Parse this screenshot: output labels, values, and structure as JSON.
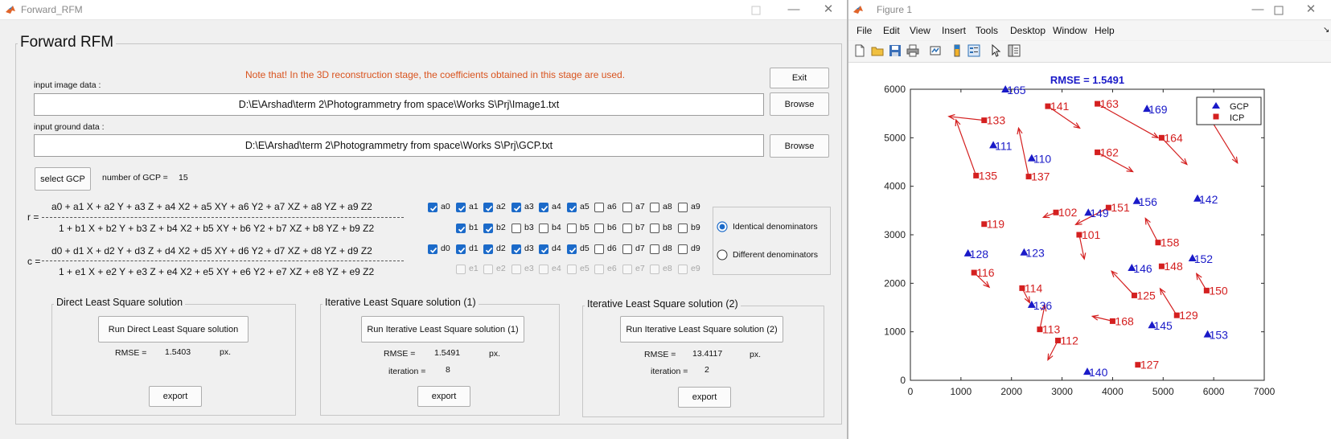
{
  "left_window": {
    "title": "Forward_RFM",
    "panel_title": "Forward RFM",
    "note": "Note that! In the 3D reconstruction stage, the coefficients obtained in this stage are used.",
    "exit_label": "Exit",
    "image_label": "input image data :",
    "image_path": "D:\\E\\Arshad\\term 2\\Photogrammetry from space\\Works S\\Prj\\Image1.txt",
    "browse_label": "Browse",
    "ground_label": "input ground data :",
    "ground_path": "D:\\E\\Arshad\\term 2\\Photogrammetry from space\\Works S\\Prj\\GCP.txt",
    "select_gcp_label": "select GCP",
    "num_gcp_label": "number of GCP =",
    "num_gcp_value": "15",
    "r_label": "r =",
    "r_num": "a0 + a1 X + a2 Y + a3 Z + a4 X2 + a5 XY + a6 Y2 + a7 XZ + a8 YZ + a9 Z2",
    "r_den": "1 + b1 X + b2 Y + b3 Z + b4 X2 + b5 XY + b6 Y2 + b7 XZ + b8 YZ + b9 Z2",
    "c_label": "c =",
    "c_num": "d0 + d1 X + d2 Y + d3 Z + d4 X2 + d5 XY + d6 Y2 + d7 XZ + d8 YZ + d9 Z2",
    "c_den": "1 + e1 X + e2 Y + e3 Z + e4 X2 + e5 XY + e6 Y2 + e7 XZ + e8 YZ + e9 Z2",
    "coef_rows": [
      {
        "labels": [
          "a0",
          "a1",
          "a2",
          "a3",
          "a4",
          "a5",
          "a6",
          "a7",
          "a8",
          "a9"
        ],
        "state": [
          "on",
          "on",
          "on",
          "on",
          "on",
          "on",
          "off",
          "off",
          "off",
          "off"
        ]
      },
      {
        "labels": [
          "",
          "b1",
          "b2",
          "b3",
          "b4",
          "b5",
          "b6",
          "b7",
          "b8",
          "b9"
        ],
        "state": [
          "none",
          "on",
          "on",
          "off",
          "off",
          "off",
          "off",
          "off",
          "off",
          "off"
        ]
      },
      {
        "labels": [
          "d0",
          "d1",
          "d2",
          "d3",
          "d4",
          "d5",
          "d6",
          "d7",
          "d8",
          "d9"
        ],
        "state": [
          "on",
          "on",
          "on",
          "on",
          "on",
          "on",
          "off",
          "off",
          "off",
          "off"
        ]
      },
      {
        "labels": [
          "",
          "e1",
          "e2",
          "e3",
          "e4",
          "e5",
          "e6",
          "e7",
          "e8",
          "e9"
        ],
        "state": [
          "none",
          "dis",
          "dis",
          "dis",
          "dis",
          "dis",
          "dis",
          "dis",
          "dis",
          "dis"
        ]
      }
    ],
    "radio_identical": "Identical denominators",
    "radio_different": "Different denominators",
    "direct": {
      "title": "Direct Least Square solution",
      "run_label": "Run Direct Least Square solution",
      "rmse_label": "RMSE =",
      "rmse_value": "1.5403",
      "unit": "px.",
      "export_label": "export"
    },
    "iter1": {
      "title": "Iterative Least Square solution (1)",
      "run_label": "Run Iterative Least Square solution (1)",
      "rmse_label": "RMSE =",
      "rmse_value": "1.5491",
      "unit": "px.",
      "iter_label": "iteration =",
      "iter_value": "8",
      "export_label": "export"
    },
    "iter2": {
      "title": "Iterative Least Square solution (2)",
      "run_label": "Run Iterative Least Square solution (2)",
      "rmse_label": "RMSE =",
      "rmse_value": "13.4117",
      "unit": "px.",
      "iter_label": "iteration =",
      "iter_value": "2",
      "export_label": "export"
    }
  },
  "right_window": {
    "title": "Figure 1",
    "menu": [
      "File",
      "Edit",
      "View",
      "Insert",
      "Tools",
      "Desktop",
      "Window",
      "Help"
    ],
    "toolbar_icons": [
      "new-file-icon",
      "open-folder-icon",
      "save-icon",
      "print-icon",
      "link-plot-icon",
      "colorbar-icon",
      "legend-icon",
      "pointer-icon",
      "property-inspector-icon"
    ]
  },
  "colors": {
    "gcp": "#1a1ac8",
    "icp": "#d42020",
    "note": "#d9531e",
    "accent": "#1b6ac9"
  },
  "chart_data": {
    "type": "scatter",
    "title": "RMSE = 1.5491",
    "xlabel": "",
    "ylabel": "",
    "xlim": [
      0,
      7000
    ],
    "ylim": [
      0,
      6000
    ],
    "xticks": [
      "0",
      "1000",
      "2000",
      "3000",
      "4000",
      "5000",
      "6000",
      "7000"
    ],
    "yticks": [
      "0",
      "1000",
      "2000",
      "3000",
      "4000",
      "5000",
      "6000"
    ],
    "legend": {
      "placement": "top-right",
      "entries": [
        "GCP",
        "ICP"
      ]
    },
    "gcp": [
      {
        "label": "165",
        "x": 1880,
        "y": 6000
      },
      {
        "label": "169",
        "x": 4680,
        "y": 5600
      },
      {
        "label": "111",
        "x": 1640,
        "y": 4850
      },
      {
        "label": "110",
        "x": 2400,
        "y": 4580
      },
      {
        "label": "156",
        "x": 4480,
        "y": 3700
      },
      {
        "label": "142",
        "x": 5680,
        "y": 3750
      },
      {
        "label": "149",
        "x": 3520,
        "y": 3460
      },
      {
        "label": "128",
        "x": 1140,
        "y": 2620
      },
      {
        "label": "123",
        "x": 2250,
        "y": 2640
      },
      {
        "label": "146",
        "x": 4380,
        "y": 2320
      },
      {
        "label": "152",
        "x": 5580,
        "y": 2520
      },
      {
        "label": "136",
        "x": 2400,
        "y": 1560
      },
      {
        "label": "145",
        "x": 4780,
        "y": 1140
      },
      {
        "label": "153",
        "x": 5880,
        "y": 950
      },
      {
        "label": "140",
        "x": 3500,
        "y": 180
      }
    ],
    "icp": [
      {
        "label": "141",
        "x": 2720,
        "y": 5650,
        "dx": 630,
        "dy": -450
      },
      {
        "label": "163",
        "x": 3700,
        "y": 5700,
        "dx": 1200,
        "dy": -700
      },
      {
        "label": "133",
        "x": 1460,
        "y": 5360,
        "dx": -700,
        "dy": 80
      },
      {
        "label": "164",
        "x": 4970,
        "y": 5000,
        "dx": 500,
        "dy": -550
      },
      {
        "label": "162",
        "x": 3700,
        "y": 4700,
        "dx": 700,
        "dy": -400
      },
      {
        "label": "135",
        "x": 1300,
        "y": 4220,
        "dx": -400,
        "dy": 1150
      },
      {
        "label": "137",
        "x": 2340,
        "y": 4200,
        "dx": -200,
        "dy": 1000
      },
      {
        "label": "102",
        "x": 2880,
        "y": 3460,
        "dx": -250,
        "dy": -100
      },
      {
        "label": "151",
        "x": 3920,
        "y": 3560,
        "dx": -650,
        "dy": -350
      },
      {
        "label": "119",
        "x": 1460,
        "y": 3220,
        "dx": 0,
        "dy": 0
      },
      {
        "label": "101",
        "x": 3340,
        "y": 3000,
        "dx": 100,
        "dy": -500
      },
      {
        "label": "158",
        "x": 4900,
        "y": 2840,
        "dx": -250,
        "dy": 500
      },
      {
        "label": "148",
        "x": 4970,
        "y": 2350,
        "dx": 0,
        "dy": 0
      },
      {
        "label": "116",
        "x": 1260,
        "y": 2220,
        "dx": 300,
        "dy": -300
      },
      {
        "label": "150",
        "x": 5860,
        "y": 1850,
        "dx": -200,
        "dy": 350
      },
      {
        "label": "114",
        "x": 2210,
        "y": 1900,
        "dx": 150,
        "dy": -300
      },
      {
        "label": "125",
        "x": 4430,
        "y": 1750,
        "dx": -450,
        "dy": 500
      },
      {
        "label": "129",
        "x": 5270,
        "y": 1340,
        "dx": -330,
        "dy": 550
      },
      {
        "label": "168",
        "x": 4000,
        "y": 1220,
        "dx": -400,
        "dy": 100
      },
      {
        "label": "113",
        "x": 2560,
        "y": 1050,
        "dx": 100,
        "dy": 500
      },
      {
        "label": "112",
        "x": 2920,
        "y": 820,
        "dx": -200,
        "dy": -400
      },
      {
        "label": "127",
        "x": 4500,
        "y": 320,
        "dx": 0,
        "dy": 0
      },
      {
        "label": "",
        "x": 5820,
        "y": 5580,
        "dx": 650,
        "dy": -1100
      }
    ]
  }
}
